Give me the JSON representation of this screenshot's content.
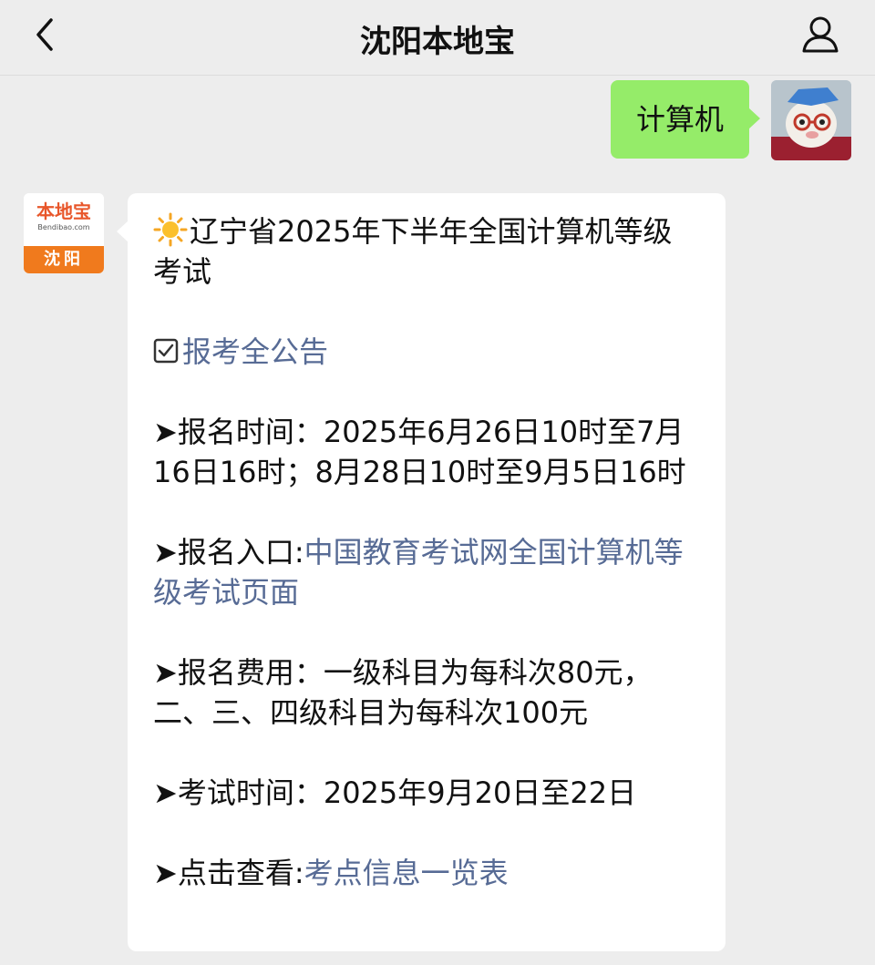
{
  "header": {
    "title": "沈阳本地宝"
  },
  "outgoing": {
    "text": "计算机"
  },
  "bot_avatar": {
    "logo_text": "本地宝",
    "logo_sub": "Bendibao.com",
    "city": "沈阳"
  },
  "message": {
    "title": "辽宁省2025年下半年全国计算机等级考试",
    "notice_link": "报考全公告",
    "reg_time_label": "➤报名时间：",
    "reg_time_value": "2025年6月26日10时至7月16日16时；8月28日10时至9月5日16时",
    "entry_label": "➤报名入口:",
    "entry_link": "中国教育考试网全国计算机等级考试页面",
    "fee_label": "➤报名费用：",
    "fee_value": "一级科目为每科次80元，二、三、四级科目为每科次100元",
    "exam_time_label": "➤考试时间：",
    "exam_time_value": "2025年9月20日至22日",
    "view_label": "➤点击查看:",
    "view_link": "考点信息一览表"
  },
  "icons": {
    "back": "chevron-left-icon",
    "profile": "person-icon",
    "title_emoji": "sun-icon",
    "checkbox": "check-box-icon"
  },
  "colors": {
    "background": "#ededed",
    "outgoing_bubble": "#95ec69",
    "link": "#576b95",
    "bot_orange": "#f07a1d"
  }
}
